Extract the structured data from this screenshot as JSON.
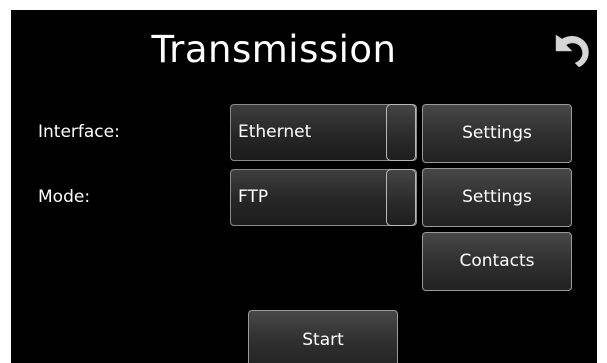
{
  "header": {
    "title": "Transmission",
    "back_icon": "undo-arrow-icon"
  },
  "interface_row": {
    "label": "Interface:",
    "value": "Ethernet",
    "settings_label": "Settings"
  },
  "mode_row": {
    "label": "Mode:",
    "value": "FTP",
    "settings_label": "Settings"
  },
  "contacts_label": "Contacts",
  "start_label": "Start",
  "colors": {
    "background": "#000000",
    "text": "#ffffff",
    "button_border": "#9a9a9a"
  }
}
